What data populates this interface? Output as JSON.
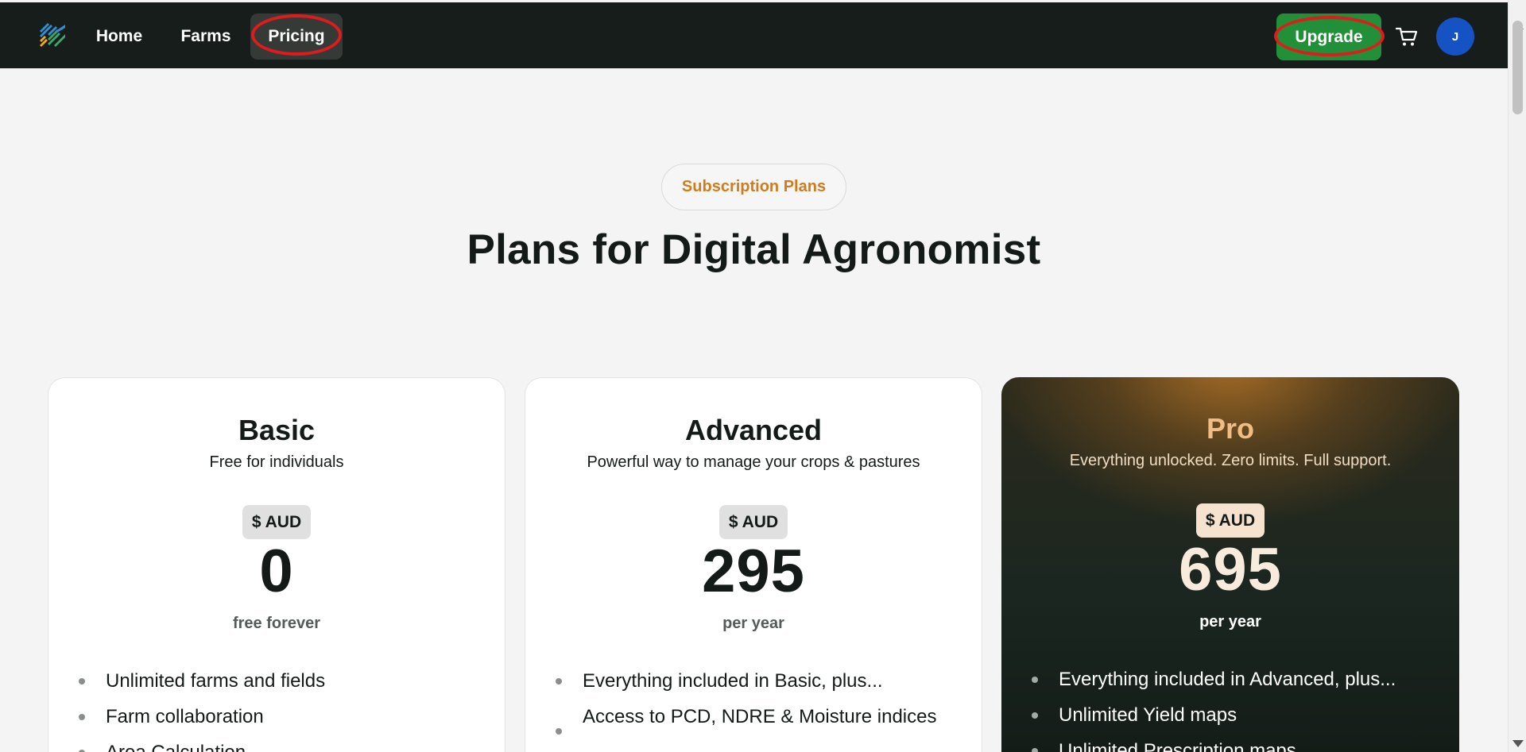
{
  "nav": {
    "home": "Home",
    "farms": "Farms",
    "pricing": "Pricing",
    "upgrade": "Upgrade",
    "avatar_initial": "J",
    "cart_icon": "cart-icon",
    "logo_icon": "stripes-logo"
  },
  "header": {
    "badge": "Subscription Plans",
    "title": "Plans for Digital Agronomist"
  },
  "plans": [
    {
      "name": "Basic",
      "subtitle": "Free for individuals",
      "currency": "$ AUD",
      "price": "0",
      "period": "free forever",
      "features": [
        "Unlimited farms and fields",
        "Farm collaboration",
        "Area Calculation"
      ]
    },
    {
      "name": "Advanced",
      "subtitle": "Powerful way to manage your crops & pastures",
      "currency": "$ AUD",
      "price": "295",
      "period": "per year",
      "features": [
        "Everything included in Basic, plus...",
        "Access to PCD, NDRE & Moisture indices"
      ]
    },
    {
      "name": "Pro",
      "subtitle": "Everything unlocked. Zero limits. Full support.",
      "currency": "$ AUD",
      "price": "695",
      "period": "per year",
      "features": [
        "Everything included in Advanced, plus...",
        "Unlimited Yield maps",
        "Unlimited Prescription maps"
      ]
    }
  ],
  "colors": {
    "nav_bg": "#161d1a",
    "accent_orange": "#d17c18",
    "upgrade_green": "#229038",
    "annotation_red": "#e01b1b",
    "avatar_blue": "#1552c4"
  }
}
